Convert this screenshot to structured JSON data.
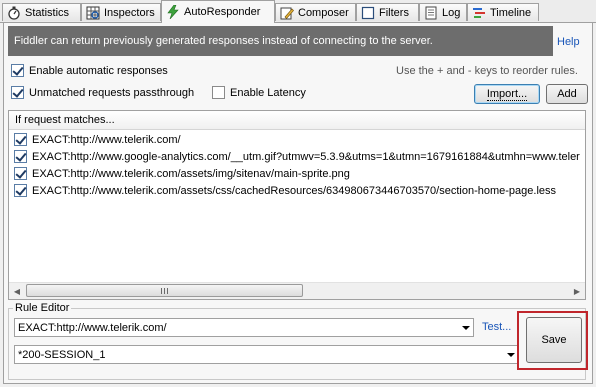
{
  "tabs": [
    {
      "label": "Statistics",
      "icon": "stopwatch-icon"
    },
    {
      "label": "Inspectors",
      "icon": "inspect-grid-icon"
    },
    {
      "label": "AutoResponder",
      "icon": "lightning-icon"
    },
    {
      "label": "Composer",
      "icon": "pencil-icon"
    },
    {
      "label": "Filters",
      "icon": "checkbox-icon"
    },
    {
      "label": "Log",
      "icon": "document-icon"
    },
    {
      "label": "Timeline",
      "icon": "timeline-icon"
    }
  ],
  "banner": {
    "text": "Fiddler can return previously generated responses instead of connecting to the server.",
    "help": "Help"
  },
  "options": {
    "enable_auto": "Enable automatic responses",
    "unmatched": "Unmatched requests passthrough",
    "latency": "Enable Latency",
    "hint": "Use the + and - keys to reorder rules.",
    "import_label": "Import...",
    "add_label": "Add"
  },
  "rules": {
    "header": "If request matches...",
    "items": [
      "EXACT:http://www.telerik.com/",
      "EXACT:http://www.google-analytics.com/__utm.gif?utmwv=5.3.9&utms=1&utmn=1679161884&utmhn=www.teler",
      "EXACT:http://www.telerik.com/assets/img/sitenav/main-sprite.png",
      "EXACT:http://www.telerik.com/assets/css/cachedResources/634980673446703570/section-home-page.less"
    ]
  },
  "editor": {
    "title": "Rule Editor",
    "match_value": "EXACT:http://www.telerik.com/",
    "action_value": "*200-SESSION_1",
    "test_label": "Test...",
    "save_label": "Save"
  },
  "colors": {
    "banner_bg": "#6d6d6d",
    "link": "#1a56b8",
    "highlight": "#c0262c"
  }
}
